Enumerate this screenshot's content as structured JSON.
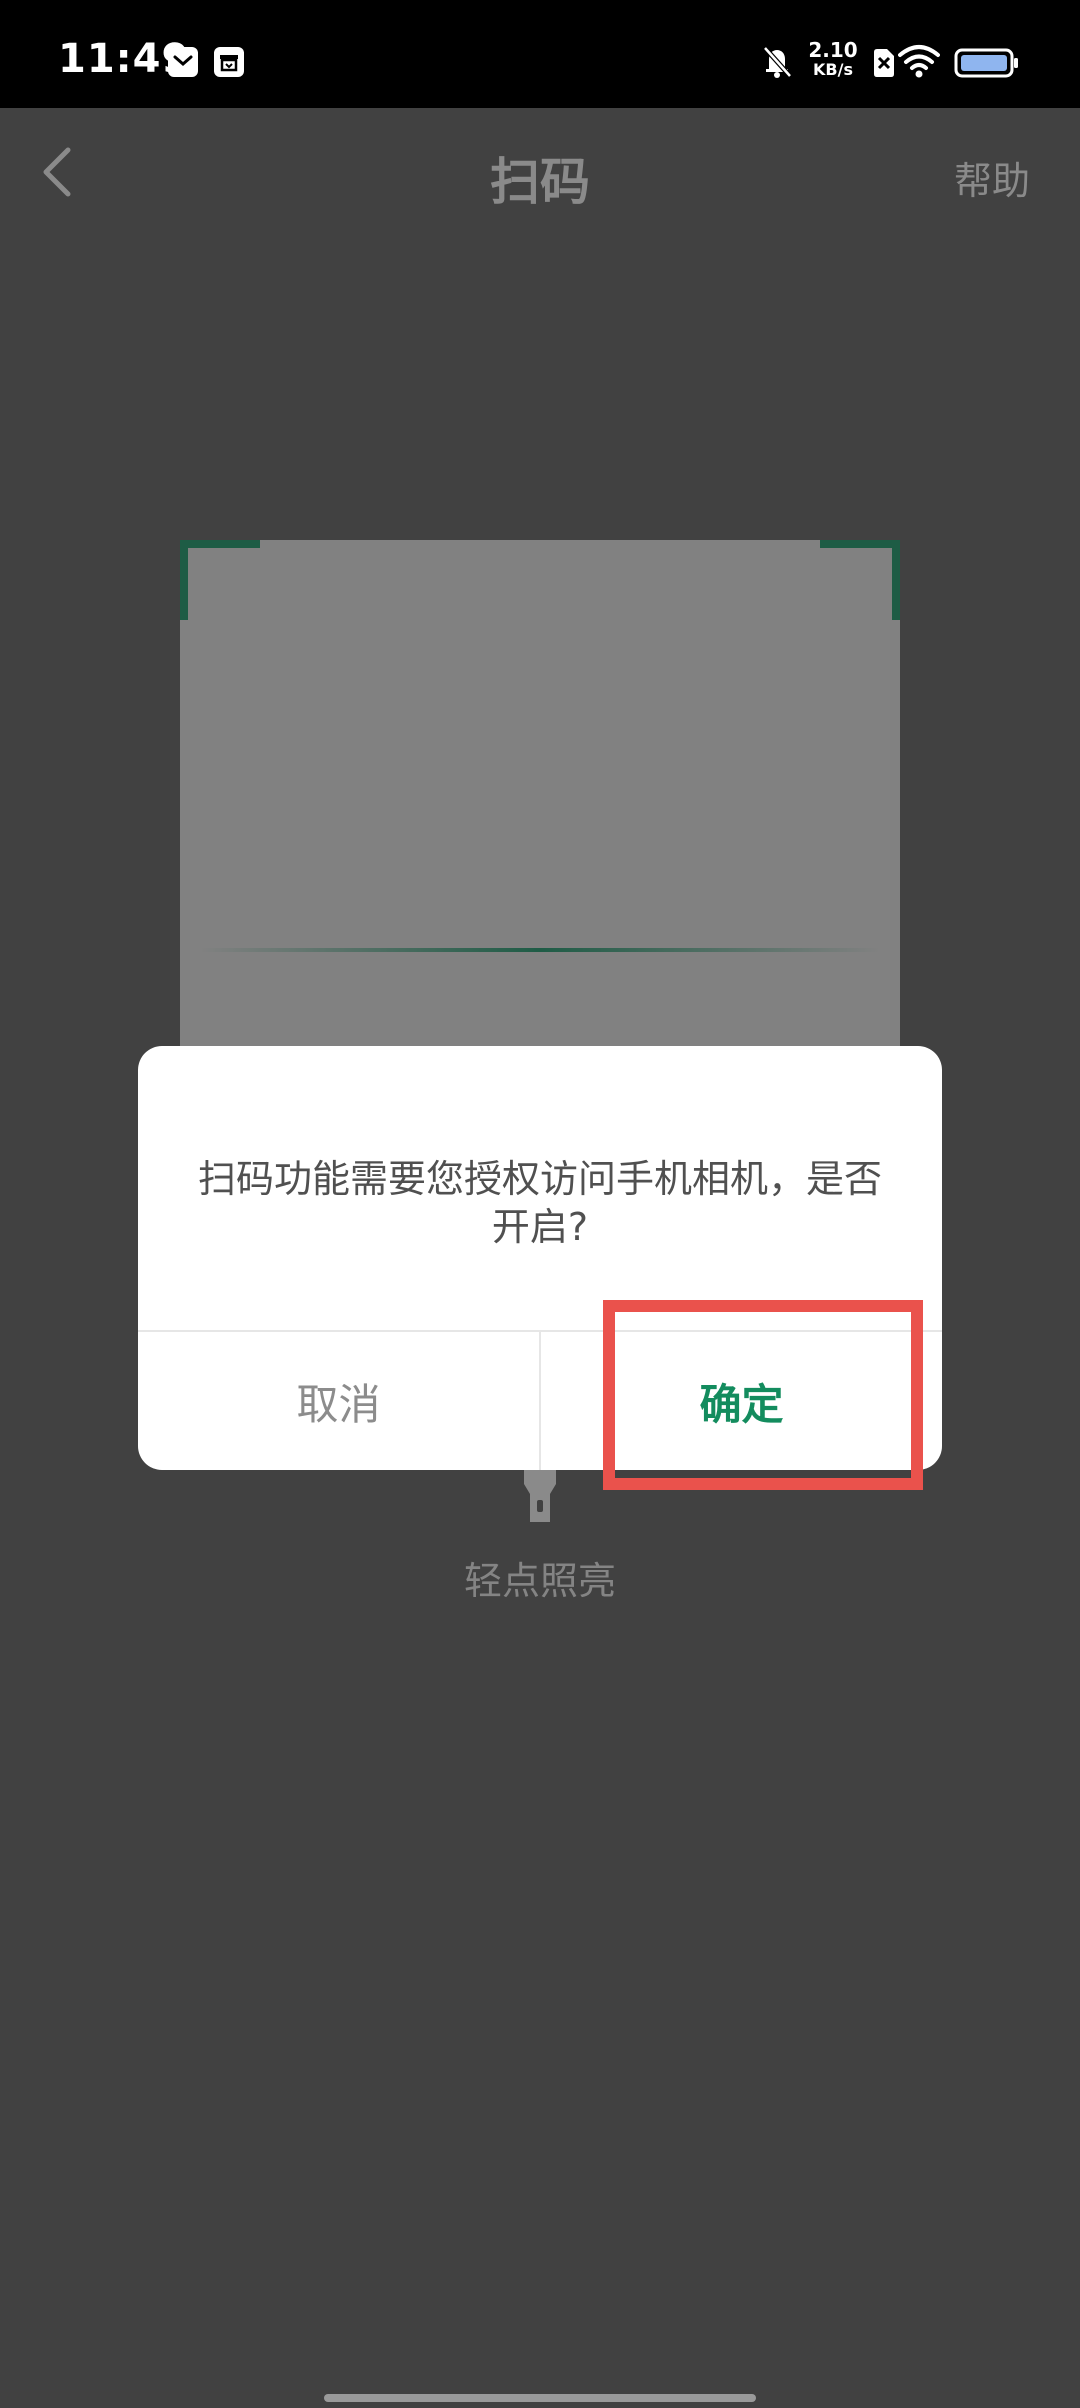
{
  "status_bar": {
    "time": "11:49",
    "net_speed_value": "2.10",
    "net_speed_unit": "KB/s",
    "icons": [
      "mail-notification-icon",
      "package-notification-icon",
      "bell-muted-icon",
      "sim-off-icon",
      "wifi-icon",
      "battery-icon"
    ]
  },
  "header": {
    "title": "扫码",
    "help_label": "帮助",
    "back_icon": "chevron-left-icon"
  },
  "scanner": {
    "torch_icon": "flashlight-icon",
    "torch_label": "轻点照亮",
    "accent_color": "#1e5c45"
  },
  "dialog": {
    "message": "扫码功能需要您授权访问手机相机，是否开启?",
    "cancel_label": "取消",
    "confirm_label": "确定",
    "confirm_color": "#138c5e"
  },
  "highlight_color": "#ea524c"
}
